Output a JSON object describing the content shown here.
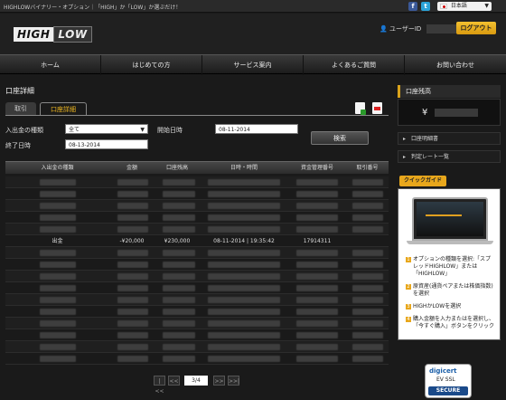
{
  "topbar": {
    "tagline": "HIGHLOWバイナリー・オプション｜「HIGH」か「LOW」か選ぶだけ！",
    "facebook_icon": "f",
    "twitter_icon": "t",
    "language": "日本語"
  },
  "header": {
    "logo_high": "HIGH",
    "logo_low": "LOW",
    "user_label": "ユーザーID",
    "logout": "ログアウト"
  },
  "nav": [
    "ホーム",
    "はじめての方",
    "サービス案内",
    "よくあるご質問",
    "お問い合わせ"
  ],
  "main": {
    "title": "口座詳細",
    "tabs": [
      "取引",
      "口座詳細"
    ],
    "filter": {
      "type_label": "入出金の種類",
      "type_value": "全て",
      "start_label": "開始日時",
      "start_value": "08-11-2014",
      "end_label": "終了日時",
      "end_value": "08-13-2014",
      "search": "検索"
    },
    "table": {
      "headers": [
        "入出金の種類",
        "金額",
        "口座残高",
        "日時・時間",
        "資金管理番号",
        "取引番号"
      ],
      "visible_row": [
        "出金",
        "-¥20,000",
        "¥230,000",
        "08-11-2014 | 19:35:42",
        "17914311",
        ""
      ]
    },
    "pager": {
      "first": "|<<",
      "prev": "<<",
      "page": "3/4",
      "next": ">>",
      "last": ">>|"
    }
  },
  "sidebar": {
    "balance_title": "口座残高",
    "currency": "¥",
    "links": [
      "口座明細書",
      "判定レート一覧"
    ],
    "guide_title": "クイックガイド",
    "steps": [
      "オプションの種類を選択:「スプレッドHIGHLOW」または「HIGHLOW」",
      "原資産(通貨ペアまたは株価指数)を選択",
      "HIGHかLOWを選択",
      "購入金額を入力またはを選択し、「今すぐ購入」ボタンをクリック"
    ]
  },
  "ssl": {
    "brand": "digicert",
    "ev": "EV SSL",
    "secure": "SECURE"
  }
}
